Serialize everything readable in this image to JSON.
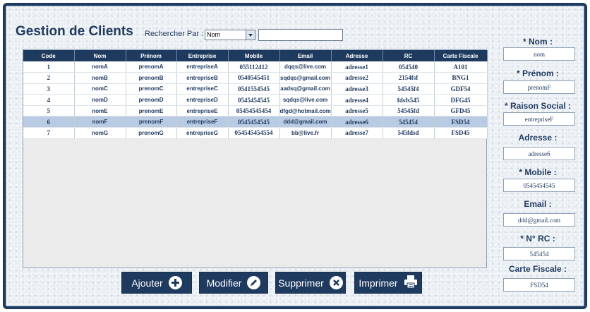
{
  "header": {
    "title": "Gestion de Clients",
    "search_label": "Rechercher Par :",
    "search_by_value": "Nom",
    "search_value": ""
  },
  "table": {
    "columns": [
      "Code",
      "Nom",
      "Prénom",
      "Entreprise",
      "Mobile",
      "Email",
      "Adresse",
      "RC",
      "Carte Fiscale"
    ],
    "rows": [
      [
        "1",
        "nomA",
        "prenomA",
        "entrepriseA",
        "055112412",
        "dqqs@live.com",
        "adresse1",
        "054540",
        "A101"
      ],
      [
        "2",
        "nomB",
        "prenomB",
        "entrepriseB",
        "0540545451",
        "sqdqs@gmail.com",
        "adresse2",
        "2154fsf",
        "BNG1"
      ],
      [
        "3",
        "nomC",
        "prenomC",
        "entrepriseC",
        "0541554545",
        "aadsq@gmail.com",
        "adresse3",
        "54545f4",
        "GDF54"
      ],
      [
        "4",
        "nomD",
        "prenomD",
        "entrepriseD",
        "0545454545",
        "sqdqs@live.com",
        "adresse4",
        "fdsfs545",
        "DFG45"
      ],
      [
        "5",
        "nomE",
        "prenomE",
        "entrepriseE",
        "05454545454",
        "dfgd@hotmail.com",
        "adresse5",
        "54545fd",
        "GFD45"
      ],
      [
        "6",
        "nomF",
        "prenomF",
        "entrepriseF",
        "0545454545",
        "ddd@gmail.com",
        "adresse6",
        "545454",
        "FSD54"
      ],
      [
        "7",
        "nomG",
        "prenomG",
        "entrepriseG",
        "054545454554",
        "bb@live.fr",
        "adresse7",
        "545fdsd",
        "FSD45"
      ]
    ],
    "selected_row": 6
  },
  "form": {
    "nom_label": "* Nom :",
    "nom_value": "nom",
    "prenom_label": "* Prénom :",
    "prenom_value": "prenomF",
    "raison_label": "* Raison Social :",
    "raison_value": "entrepriseF",
    "adresse_label": "Adresse :",
    "adresse_value": "adresse6",
    "mobile_label": "* Mobile :",
    "mobile_value": "0545454545",
    "email_label": "Email :",
    "email_value": "ddd@gmail.com",
    "rc_label": "* N° RC :",
    "rc_value": "545454",
    "carte_label": "Carte Fiscale :",
    "carte_value": "FSD54"
  },
  "buttons": {
    "ajouter": "Ajouter",
    "modifier": "Modifier",
    "supprimer": "Supprimer",
    "imprimer": "Imprimer"
  },
  "icons": {
    "add": "plus-icon",
    "edit": "pencil-icon",
    "delete": "close-icon",
    "print": "printer-icon"
  },
  "colors": {
    "primary": "#1f3a5f",
    "selected_row": "#b9cbe3",
    "background": "#e9eef3"
  }
}
